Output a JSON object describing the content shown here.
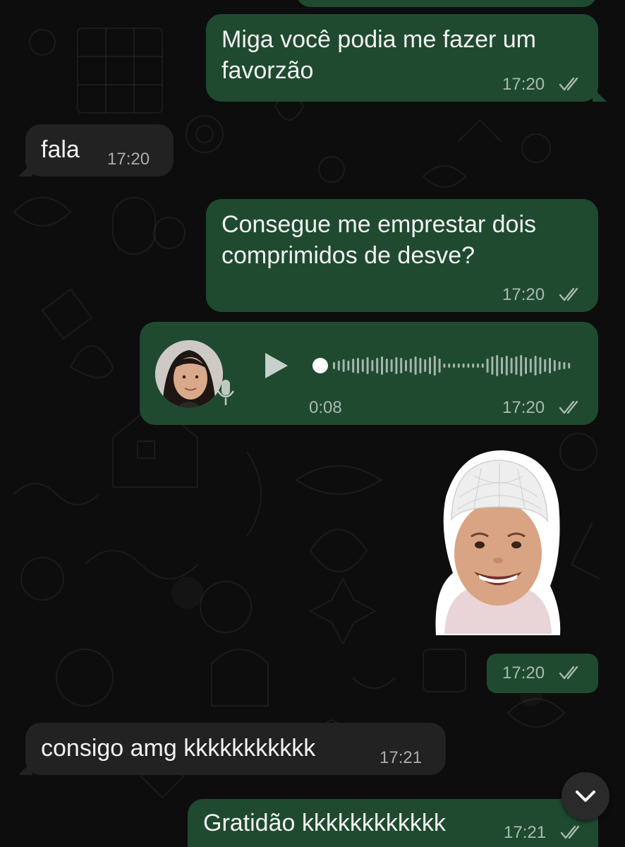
{
  "messages": [
    {
      "id": "m1",
      "direction": "outgoing",
      "text": "Miga você podia me fazer um favorzão",
      "time": "17:20",
      "status": "read"
    },
    {
      "id": "m2",
      "direction": "incoming",
      "text": "fala",
      "time": "17:20"
    },
    {
      "id": "m3",
      "direction": "outgoing",
      "text": "Consegue me emprestar dois comprimidos de desve?",
      "time": "17:20",
      "status": "read"
    },
    {
      "id": "m4",
      "direction": "outgoing",
      "type": "voice",
      "duration": "0:08",
      "time": "17:20",
      "status": "read",
      "progress": 0
    },
    {
      "id": "m5",
      "direction": "outgoing",
      "type": "sticker",
      "time": "17:20",
      "status": "read"
    },
    {
      "id": "m6",
      "direction": "incoming",
      "text": "consigo amg kkkkkkkkkkk",
      "time": "17:21"
    },
    {
      "id": "m7",
      "direction": "outgoing",
      "text": "Gratidão kkkkkkkkkkkk",
      "time": "17:21",
      "status": "read"
    }
  ],
  "icons": {
    "read_ticks": "double-check-icon",
    "play": "play-icon",
    "mic": "microphone-icon",
    "scroll_down": "chevron-down-icon"
  },
  "colors": {
    "outgoing_bubble": "#1f4a30",
    "incoming_bubble": "#222222",
    "background": "#0d0d0d"
  }
}
